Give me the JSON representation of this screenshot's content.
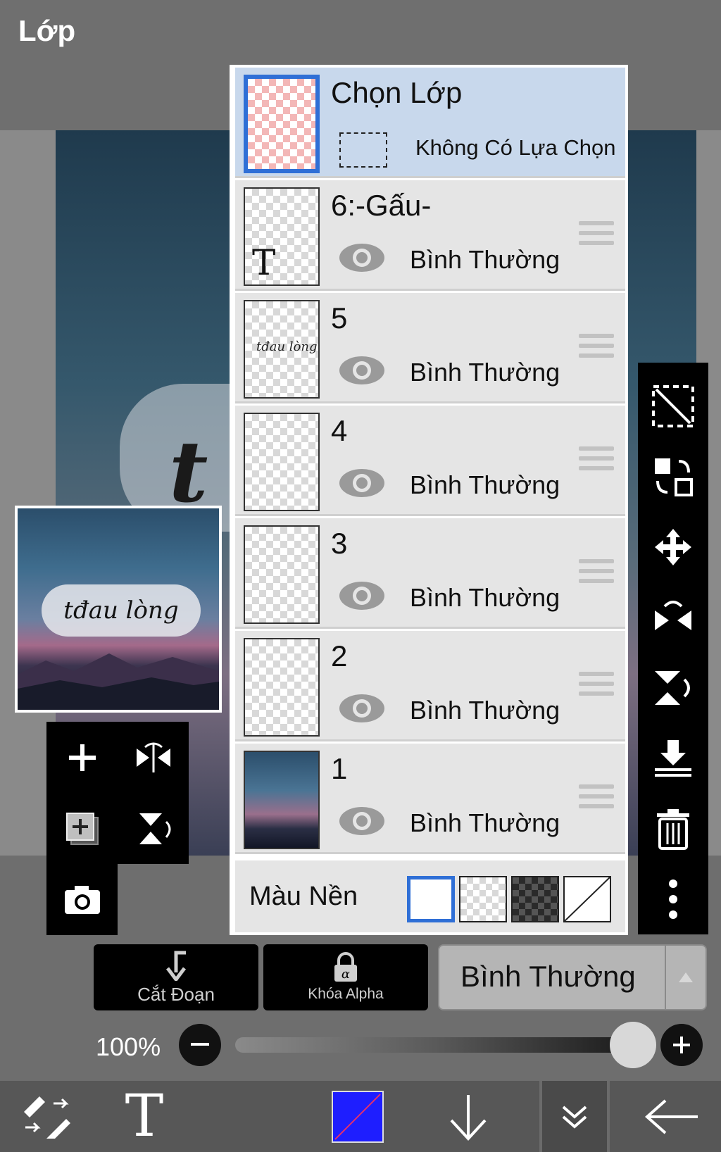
{
  "header": {
    "title": "Lớp"
  },
  "canvas": {
    "preview_text": "tđau lòng"
  },
  "layers": {
    "select_layer": {
      "title": "Chọn Lớp",
      "status": "Không Có Lựa Chọn"
    },
    "items": [
      {
        "name": "6:-Gấu-",
        "blend": "Bình Thường"
      },
      {
        "name": "5",
        "blend": "Bình Thường"
      },
      {
        "name": "4",
        "blend": "Bình Thường"
      },
      {
        "name": "3",
        "blend": "Bình Thường"
      },
      {
        "name": "2",
        "blend": "Bình Thường"
      },
      {
        "name": "1",
        "blend": "Bình Thường"
      }
    ],
    "text_layer_glyph": "T",
    "background": {
      "label": "Màu Nền",
      "selected": "white"
    }
  },
  "controls": {
    "clipping_label": "Cắt Đoạn",
    "alpha_lock_label": "Khóa Alpha",
    "blend_mode": "Bình Thường",
    "opacity_label": "100%",
    "opacity_value": 1.0
  },
  "colors": {
    "accent": "#2f6fd6",
    "selected_row": "#c8d8ec",
    "current_color": "#1e1eff"
  },
  "icons": {
    "left": [
      "plus-icon",
      "flip-horizontal-icon",
      "add-copy-icon",
      "flip-vertical-icon",
      "camera-icon"
    ],
    "right": [
      "selection-icon",
      "swap-icon",
      "move-icon",
      "flip-h-icon",
      "flip-v-icon",
      "merge-down-icon",
      "trash-icon",
      "more-icon"
    ],
    "nav": [
      "brush-eraser-icon",
      "text-tool-icon",
      "color-swatch-icon",
      "arrow-down-icon",
      "chevron-double-down-icon",
      "back-arrow-icon"
    ]
  }
}
